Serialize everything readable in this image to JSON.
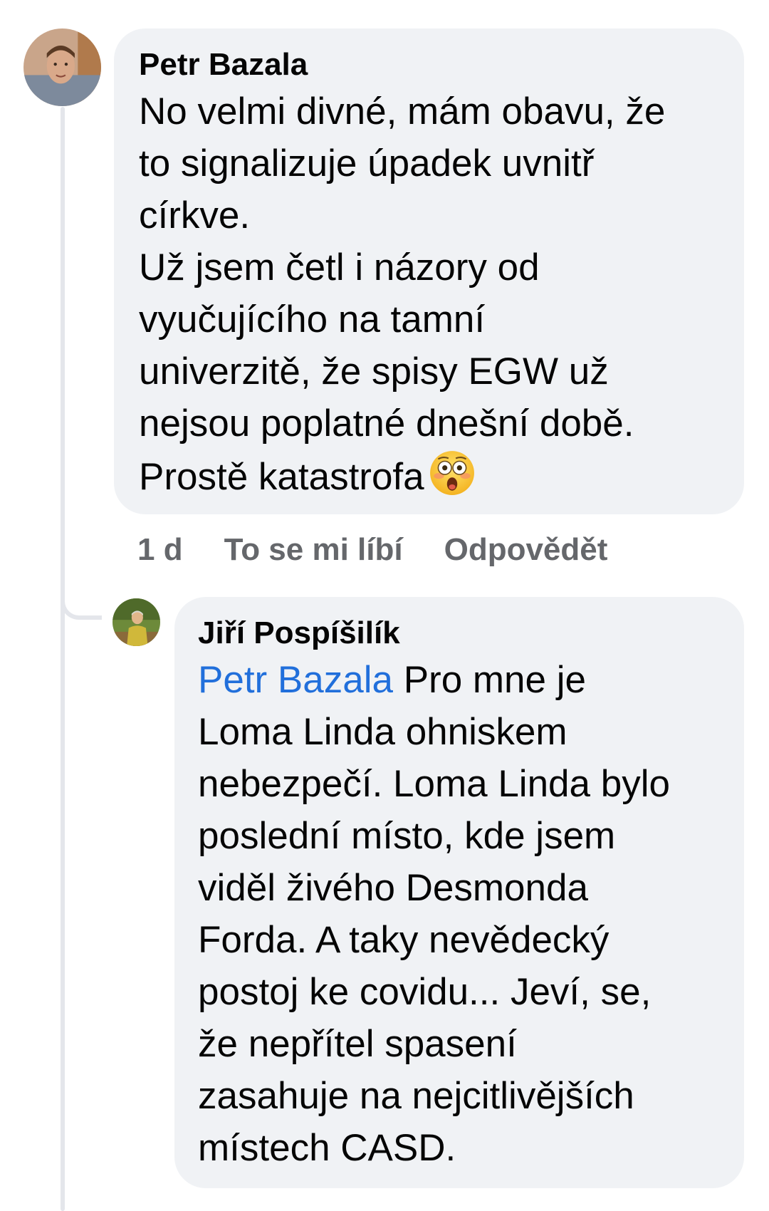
{
  "comments": [
    {
      "author": "Petr Bazala",
      "lines": [
        "No velmi divné, mám obavu, že",
        "to signalizuje úpadek uvnitř",
        "církve.",
        "Už jsem četl i názory od",
        "vyučujícího na tamní",
        "univerzitě, že spisy EGW už",
        "nejsou poplatné dnešní době.",
        "Prostě katastrofa"
      ],
      "emoji": "astonished-face-emoji",
      "time": "1 d",
      "like_label": "To se mi líbí",
      "reply_label": "Odpovědět"
    }
  ],
  "reply": {
    "author": "Jiří Pospíšilík",
    "mention": "Petr Bazala",
    "lines": [
      " Pro mne je",
      "Loma Linda ohniskem",
      "nebezpečí. Loma Linda bylo",
      "poslední místo, kde jsem",
      "viděl živého Desmonda",
      "Forda. A taky nevědecký",
      "postoj ke covidu... Jeví, se,",
      "že nepřítel spasení",
      "zasahuje na nejcitlivějších",
      "místech CASD."
    ]
  },
  "colors": {
    "bubble": "#f0f2f5",
    "text": "#050505",
    "secondary": "#65676b",
    "mention": "#216fdb",
    "thread_line": "#e4e6eb"
  }
}
